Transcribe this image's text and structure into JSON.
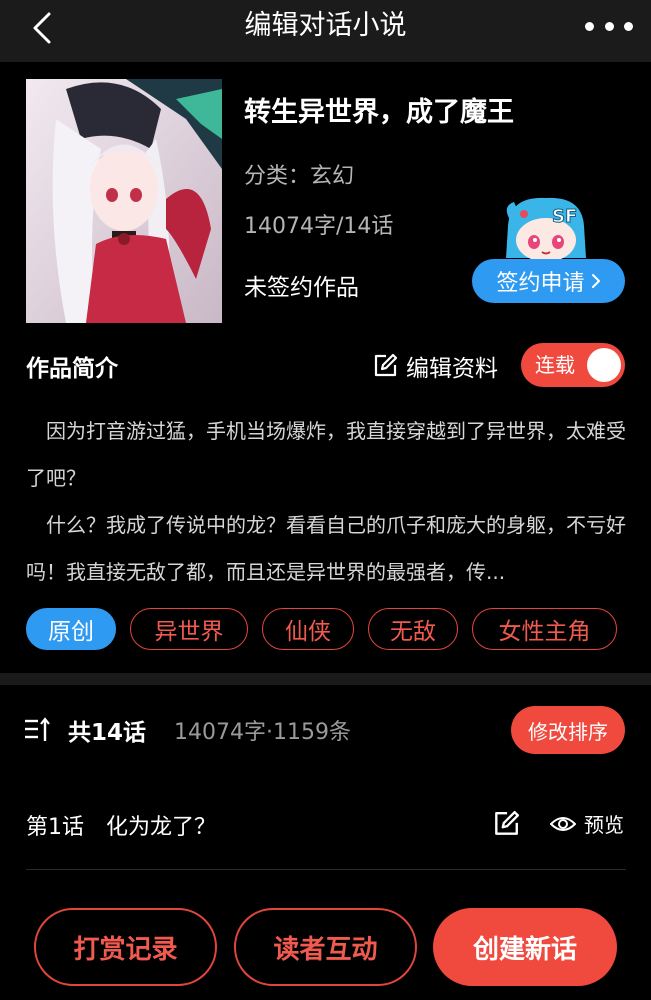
{
  "header": {
    "title": "编辑对话小说"
  },
  "novel": {
    "title": "转生异世界，成了魔王",
    "category": "分类：玄幻",
    "word_count": "14074字/14话",
    "sign_status": "未签约作品",
    "sign_button": "签约申请",
    "mascot_text": "SF"
  },
  "intro": {
    "heading": "作品简介",
    "edit_label": "编辑资料",
    "serial_label": "连载",
    "paragraph1": "因为打音游过猛，手机当场爆炸，我直接穿越到了异世界，太难受了吧？",
    "paragraph2": "什么？我成了传说中的龙？看看自己的爪子和庞大的身躯，不亏好吗！我直接无敌了都，而且还是异世界的最强者，传..."
  },
  "tags": [
    {
      "label": "原创"
    },
    {
      "label": "异世界"
    },
    {
      "label": "仙侠"
    },
    {
      "label": "无敌"
    },
    {
      "label": "女性主角"
    }
  ],
  "chapters": {
    "count_label": "共14话",
    "stats": "14074字·1159条",
    "sort_button": "修改排序",
    "items": [
      {
        "number": "第1话",
        "name": "化为龙了？",
        "preview_label": "预览"
      }
    ]
  },
  "actions": {
    "tips_record": "打赏记录",
    "reader_interaction": "读者互动",
    "create_chapter": "创建新话"
  },
  "colors": {
    "accent_red": "#f0493e",
    "accent_blue": "#2e9af2",
    "background": "#000000"
  }
}
